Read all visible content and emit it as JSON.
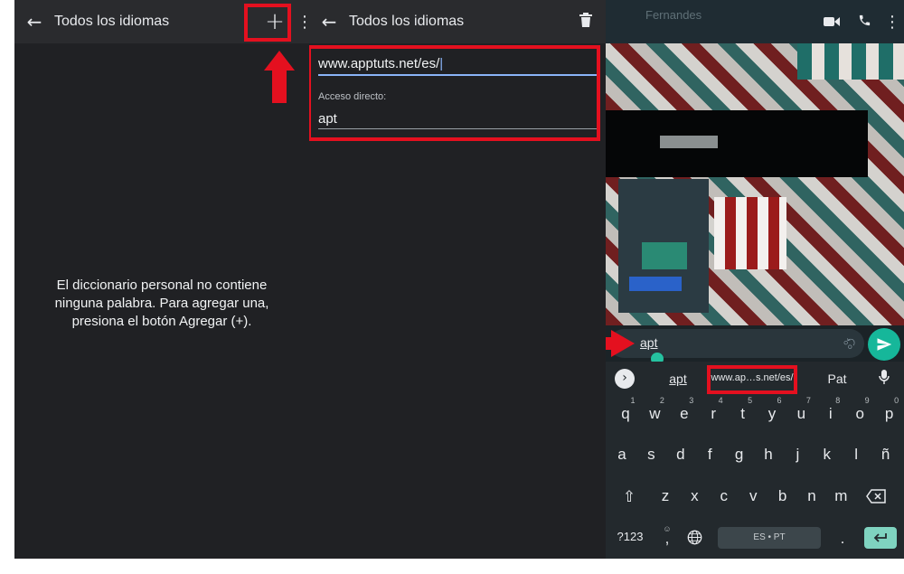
{
  "colors": {
    "highlight": "#e4101f",
    "accent": "#25c2a0",
    "send": "#16b79a",
    "bg": "#202124"
  },
  "panel1": {
    "title": "Todos los idiomas",
    "empty_message": "El diccionario personal no contiene ninguna palabra. Para agregar una, presiona el botón Agregar (+)."
  },
  "panel2": {
    "title": "Todos los idiomas",
    "word_value": "www.apptuts.net/es/",
    "shortcut_label": "Acceso directo:",
    "shortcut_value": "apt"
  },
  "panel3": {
    "contact_name": "Fernandes",
    "message_text": "apt",
    "suggestions": [
      "apt",
      "www.ap…s.net/es/",
      "Pat"
    ],
    "keyboard": {
      "row1": [
        "q",
        "w",
        "e",
        "r",
        "t",
        "y",
        "u",
        "i",
        "o",
        "p"
      ],
      "row1_hints": [
        "1",
        "2",
        "3",
        "4",
        "5",
        "6",
        "7",
        "8",
        "9",
        "0"
      ],
      "row2": [
        "a",
        "s",
        "d",
        "f",
        "g",
        "h",
        "j",
        "k",
        "l",
        "ñ"
      ],
      "row3": [
        "z",
        "x",
        "c",
        "v",
        "b",
        "n",
        "m"
      ],
      "sym_key": "?123",
      "comma_key": ",",
      "space_label": "ES • PT",
      "period_key": "."
    }
  }
}
